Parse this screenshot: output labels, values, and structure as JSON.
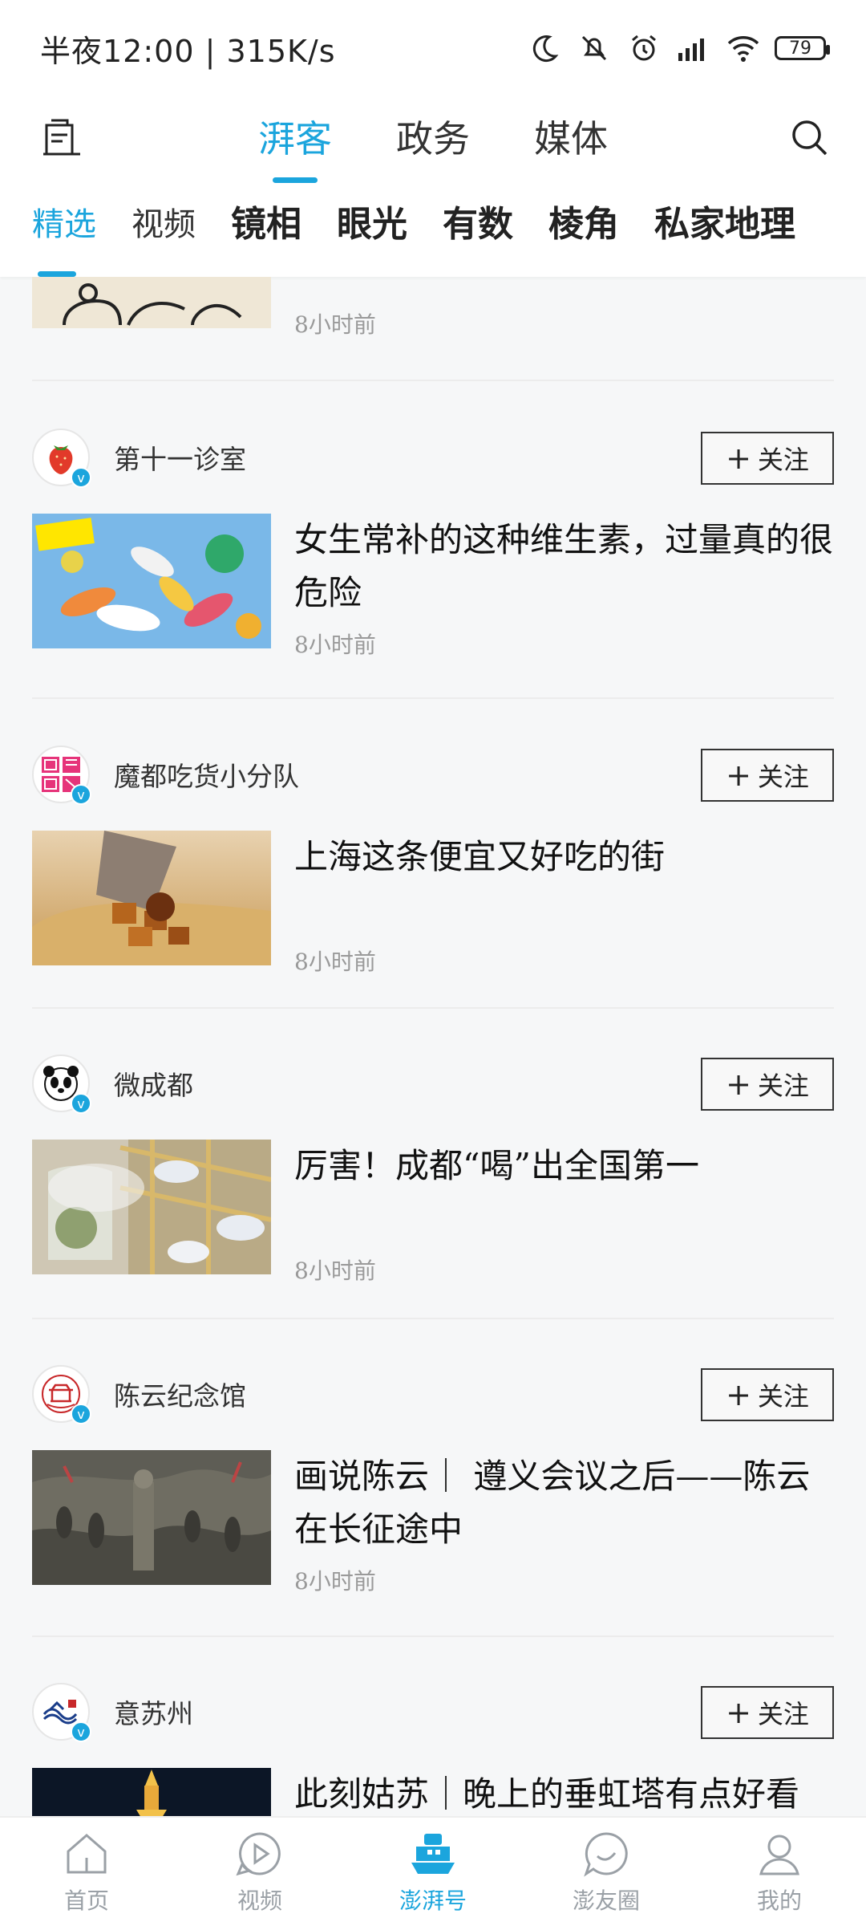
{
  "status_bar": {
    "time": "半夜12:00 | 315K/s",
    "battery": "79"
  },
  "top_nav": {
    "tabs": [
      "湃客",
      "政务",
      "媒体"
    ],
    "active_tab": "湃客"
  },
  "sub_tabs": [
    "精选",
    "视频",
    "镜相",
    "眼光",
    "有数",
    "棱角",
    "私家地理"
  ],
  "partial_item": {
    "time": "8小时前"
  },
  "feed": [
    {
      "author": "第十一诊室",
      "follow": "关注",
      "title": "女生常补的这种维生素，过量真的很危险",
      "time": "8小时前"
    },
    {
      "author": "魔都吃货小分队",
      "follow": "关注",
      "title": "上海这条便宜又好吃的街",
      "time": "8小时前"
    },
    {
      "author": "微成都",
      "follow": "关注",
      "title": "厉害！成都“喝”出全国第一",
      "time": "8小时前"
    },
    {
      "author": "陈云纪念馆",
      "follow": "关注",
      "title": "画说陈云｜ 遵义会议之后——陈云在长征途中",
      "time": "8小时前"
    },
    {
      "author": "意苏州",
      "follow": "关注",
      "title": "此刻姑苏｜晚上的垂虹塔有点好看",
      "time": ""
    }
  ],
  "bottom_nav": [
    {
      "label": "首页",
      "icon": "home-icon"
    },
    {
      "label": "视频",
      "icon": "video-icon"
    },
    {
      "label": "澎湃号",
      "icon": "ship-icon"
    },
    {
      "label": "澎友圈",
      "icon": "chat-icon"
    },
    {
      "label": "我的",
      "icon": "user-icon"
    }
  ],
  "colors": {
    "accent": "#1ba5dd"
  }
}
